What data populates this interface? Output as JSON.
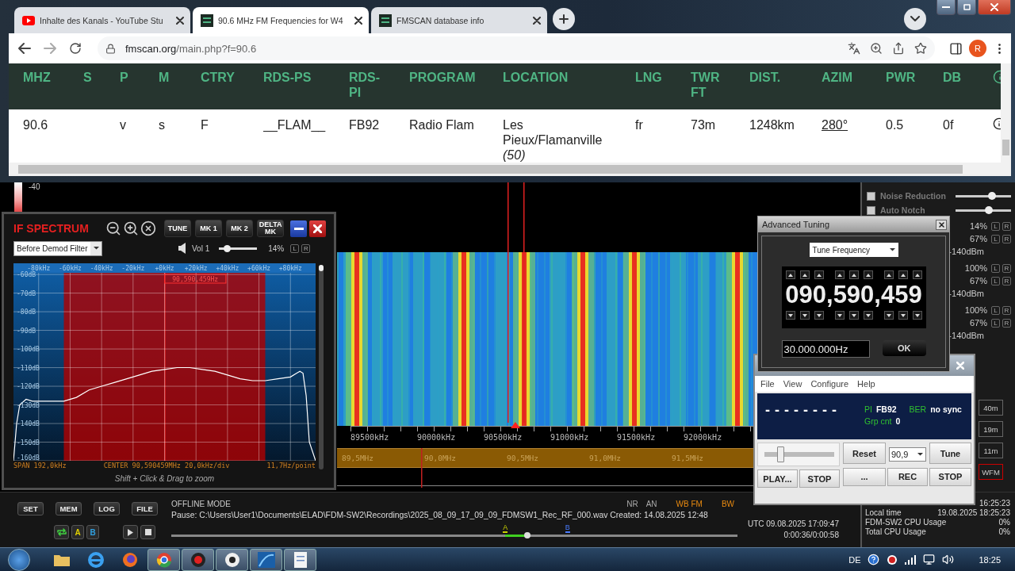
{
  "browser": {
    "tabs": [
      {
        "title": "Inhalte des Kanals - YouTube Stu",
        "kind": "youtube",
        "selected": false
      },
      {
        "title": "90.6 MHz FM Frequencies for W4",
        "kind": "fmscan",
        "selected": true
      },
      {
        "title": "FMSCAN database info",
        "kind": "fmscan",
        "selected": false
      }
    ],
    "url_host": "fmscan.org",
    "url_path": "/main.php?f=90.6",
    "avatar": "R"
  },
  "table": {
    "columns": [
      "MHZ",
      "S",
      "P",
      "M",
      "CTRY",
      "RDS-PS",
      "RDS-PI",
      "PROGRAM",
      "LOCATION",
      "LNG",
      "TWR FT",
      "DIST.",
      "AZIM",
      "PWR",
      "DB"
    ],
    "rows": [
      {
        "cells": [
          {
            "text": "90.6",
            "kind": "text"
          },
          {
            "text": "",
            "kind": "text"
          },
          {
            "text": "v",
            "kind": "text"
          },
          {
            "text": "s",
            "kind": "text"
          },
          {
            "text": "F",
            "kind": "text"
          },
          {
            "text": "__FLAM__",
            "kind": "text"
          },
          {
            "text": "FB92",
            "kind": "text"
          },
          {
            "text": "Radio Flam",
            "kind": "text"
          },
          {
            "text": "Les Pieux/Flamanville *(50)*",
            "kind": "text"
          },
          {
            "text": "fr",
            "kind": "text"
          },
          {
            "text": "73m",
            "kind": "text"
          },
          {
            "text": "1248km",
            "kind": "text"
          },
          {
            "text": "280°",
            "kind": "link"
          },
          {
            "text": "0.5",
            "kind": "text"
          },
          {
            "text": "0f",
            "kind": "text"
          }
        ]
      }
    ]
  },
  "scale_label": "-40",
  "if_spectrum": {
    "title": "IF SPECTRUM",
    "buttons": [
      "TUNE",
      "MK 1",
      "MK 2",
      "DELTA MK"
    ],
    "filter": "Before Demod Filter",
    "volume_label": "Vol 1",
    "volume": {
      "level": 0.14
    },
    "volume_reading": "14%",
    "lr": [
      "L",
      "R"
    ],
    "marker_label": "90,590,459Hz",
    "span": "SPAN 192,0kHz",
    "center": "CENTER 90,590459MHz 20,0kHz/div",
    "resolution": "11,7Hz/point",
    "hint": "Shift + Click & Drag to zoom",
    "chart_data": {
      "type": "line",
      "grid": true,
      "x": [
        -96,
        -94,
        -92,
        -88,
        -84,
        -80,
        -72,
        -64,
        -56,
        -48,
        -40,
        -32,
        -24,
        -16,
        -8,
        0,
        8,
        16,
        24,
        32,
        40,
        48,
        56,
        64,
        72,
        80,
        84,
        86,
        88,
        90,
        92,
        96
      ],
      "series": [
        {
          "color": "#ffffff",
          "values": [
            -160,
            -140,
            -130,
            -127,
            -128,
            -128,
            -128,
            -128,
            -126,
            -122,
            -120,
            -118,
            -116,
            -114,
            -112,
            -111,
            -110,
            -110,
            -111,
            -112,
            -114,
            -116,
            -117,
            -117,
            -116,
            -115,
            -113,
            -112,
            -113,
            -125,
            -150,
            -160
          ]
        }
      ],
      "xlim": [
        -96,
        96
      ],
      "ylim": [
        -160,
        -54
      ],
      "xticks": [
        {
          "value": -80,
          "label": "-80kHz"
        },
        {
          "value": -60,
          "label": "-60kHz"
        },
        {
          "value": -40,
          "label": "-40kHz"
        },
        {
          "value": -20,
          "label": "-20kHz"
        },
        {
          "value": 0,
          "label": "+0kHz"
        },
        {
          "value": 20,
          "label": "+20kHz"
        },
        {
          "value": 40,
          "label": "+40kHz"
        },
        {
          "value": 60,
          "label": "+60kHz"
        },
        {
          "value": 80,
          "label": "+80kHz"
        }
      ],
      "yticks": [
        {
          "value": -60,
          "label": "-60dB"
        },
        {
          "value": -70,
          "label": "-70dB"
        },
        {
          "value": -80,
          "label": "-80dB"
        },
        {
          "value": -90,
          "label": "-90dB"
        },
        {
          "value": -100,
          "label": "-100dB"
        },
        {
          "value": -110,
          "label": "-110dB"
        },
        {
          "value": -120,
          "label": "-120dB"
        },
        {
          "value": -130,
          "label": "-130dB"
        },
        {
          "value": -140,
          "label": "-140dB"
        },
        {
          "value": -150,
          "label": "-150dB"
        },
        {
          "value": -160,
          "label": "-160dB"
        }
      ]
    }
  },
  "waterfall": {
    "freq_ticks": [
      "89500kHz",
      "90000kHz",
      "90500kHz",
      "91000kHz",
      "91500kHz",
      "92000kHz"
    ],
    "band_ticks": [
      "89,5MHz",
      "90,0MHz",
      "90,5MHz",
      "91,0MHz",
      "91,5MHz"
    ]
  },
  "advanced_tuning": {
    "title": "Advanced Tuning",
    "mode": "Tune Frequency",
    "digits": "090,590,459",
    "step": "30.000.000Hz",
    "ok": "OK"
  },
  "rds": {
    "menu": [
      "File",
      "View",
      "Configure",
      "Help"
    ],
    "ps": "--------",
    "pi_label": "PI",
    "pi": "FB92",
    "ber_label": "BER",
    "ber": "no sync",
    "grp_label": "Grp cnt",
    "grp": "0",
    "slider": {
      "level": 0.2
    },
    "reset": "Reset",
    "station": "90,9",
    "tune": "Tune",
    "buttons": [
      "PLAY...",
      "STOP",
      "...",
      "REC",
      "STOP"
    ]
  },
  "sidebar": {
    "toggles": [
      {
        "label": "Noise Reduction",
        "checked": false,
        "level": 0.68
      },
      {
        "label": "Auto Notch",
        "checked": false,
        "level": 0.62
      }
    ],
    "readings": [
      {
        "text": "14%",
        "lr": [
          "L",
          "R"
        ]
      },
      {
        "text": "67%",
        "lr": [
          "L",
          "R"
        ]
      },
      {
        "text": "-140dBm"
      },
      {
        "text": "100%",
        "lr": [
          "L",
          "R"
        ]
      },
      {
        "text": "67%",
        "lr": [
          "L",
          "R"
        ]
      },
      {
        "text": "-140dBm"
      },
      {
        "text": "100%",
        "lr": [
          "L",
          "R"
        ]
      },
      {
        "text": "67%",
        "lr": [
          "L",
          "R"
        ]
      },
      {
        "text": "-140dBm"
      }
    ],
    "bands": [
      {
        "label": "40m",
        "selected": false
      },
      {
        "label": "19m",
        "selected": false
      },
      {
        "label": "11m",
        "selected": false
      },
      {
        "label": "WFM",
        "selected": true
      }
    ]
  },
  "status": {
    "buttons": [
      "SET",
      "MEM",
      "LOG",
      "FILE"
    ],
    "ab": [
      {
        "label": "A",
        "color": "#e0d000"
      },
      {
        "label": "B",
        "color": "#30a0e0"
      }
    ],
    "mode": "OFFLINE MODE",
    "flags": [
      {
        "label": "NR",
        "on": false
      },
      {
        "label": "AN",
        "on": false
      },
      {
        "label": "WB FM",
        "on": true
      },
      {
        "label": "BW",
        "on": true
      }
    ],
    "file": "Pause: C:\\Users\\User1\\Documents\\ELAD\\FDM-SW2\\Recordings\\2025_08_09_17_09_09_FDMSW1_Rec_RF_000.wav Created: 14.08.2025 12:48",
    "playback": {
      "level": 0.63
    },
    "markers": [
      {
        "label": "A",
        "level": 0.59,
        "color": "#c8d000"
      },
      {
        "label": "B",
        "level": 0.7,
        "color": "#4a7cff"
      }
    ],
    "utc": "UTC 09.08.2025 17:09:47",
    "position": "0:00:36/0:00:58",
    "clock": "16:25:23",
    "local_time_label": "Local time",
    "local_time": "19.08.2025 18:25:23",
    "cpu": [
      {
        "label": "FDM-SW2 CPU Usage",
        "value": "0%"
      },
      {
        "label": "Total CPU Usage",
        "value": "0%"
      }
    ]
  },
  "taskbar": {
    "apps": [
      {
        "kind": "folder",
        "running": false
      },
      {
        "kind": "ie",
        "running": false
      },
      {
        "kind": "firefox",
        "running": false
      },
      {
        "kind": "chrome",
        "running": true
      },
      {
        "kind": "record",
        "running": true
      },
      {
        "kind": "disc",
        "running": true
      },
      {
        "kind": "fdm",
        "running": true
      },
      {
        "kind": "notepad",
        "running": true
      }
    ],
    "language": "DE",
    "time": "18:25"
  }
}
